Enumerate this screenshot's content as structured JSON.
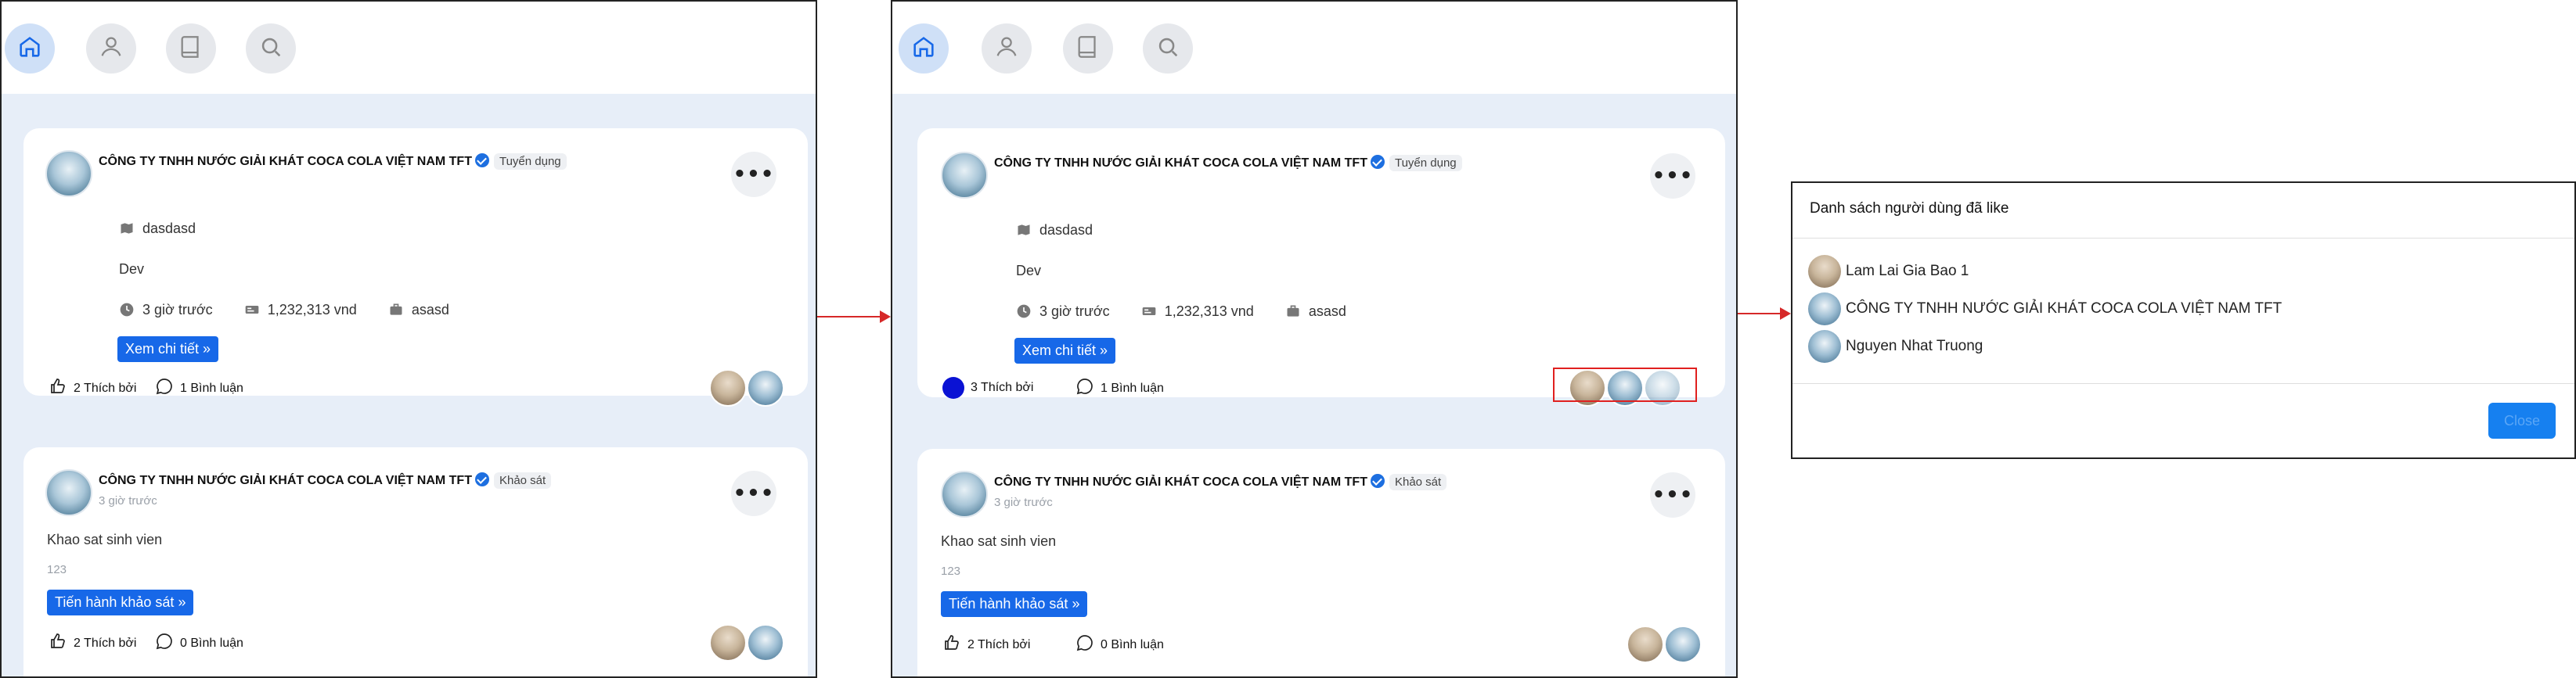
{
  "company": "CÔNG TY TNHH NƯỚC GIẢI KHÁT COCA COLA VIỆT NAM TFT",
  "posts": [
    {
      "tag": "Tuyển dụng",
      "location": "dasdasd",
      "title": "Dev",
      "time": "3 giờ trước",
      "salary": "1,232,313 vnd",
      "type": "asasd",
      "button": "Xem chi tiết",
      "likes_before": "2 Thích bởi",
      "likes_after": "3 Thích bởi",
      "comments": "1 Bình luận"
    },
    {
      "tag": "Khảo sát",
      "time": "3 giờ trước",
      "title": "Khao sat sinh vien",
      "desc": "123",
      "button": "Tiến hành khảo sát",
      "likes": "2 Thích bởi",
      "comments": "0 Bình luận"
    }
  ],
  "modal": {
    "title": "Danh sách người dùng đã like",
    "users": [
      "Lam Lai Gia Bao 1",
      "CÔNG TY TNHH NƯỚC GIẢI KHÁT COCA COLA VIỆT NAM TFT",
      "Nguyen Nhat Truong"
    ],
    "close": "Close"
  },
  "colors": {
    "primary": "#1768e8",
    "highlight": "#e0201f",
    "feed_bg": "#e7eef8",
    "liked_dot": "#0a12d4"
  },
  "icons": [
    "home-icon",
    "user-icon",
    "book-icon",
    "search-icon",
    "map-icon",
    "clock-icon",
    "money-icon",
    "briefcase-icon",
    "thumb-up-icon",
    "comment-icon",
    "more-icon"
  ]
}
